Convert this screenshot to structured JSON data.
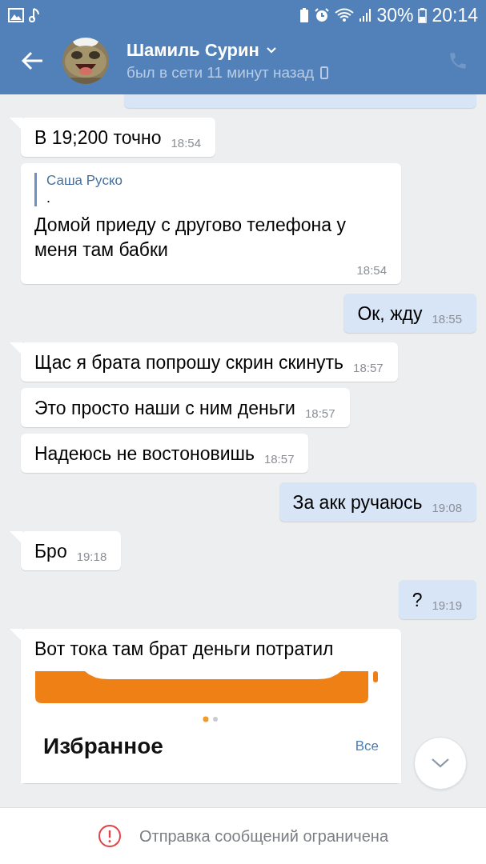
{
  "status_bar": {
    "battery": "30%",
    "time": "20:14"
  },
  "header": {
    "name": "Шамиль Сурин",
    "status": "был в сети 11 минут назад"
  },
  "messages": [
    {
      "kind": "stub",
      "outgoing": true
    },
    {
      "kind": "text",
      "outgoing": false,
      "tail": true,
      "text": "В 19;200 точно",
      "time": "18:54"
    },
    {
      "kind": "reply",
      "outgoing": false,
      "tail": false,
      "quote_author": "Саша Руско",
      "quote_text": ".",
      "text": "Домой приеду с другово телефона  у меня там бабки",
      "time": "18:54"
    },
    {
      "kind": "text",
      "outgoing": true,
      "tail": false,
      "text": "Ок, жду",
      "time": "18:55"
    },
    {
      "kind": "text",
      "outgoing": false,
      "tail": true,
      "text": "Щас я брата попрошу скрин скинуть",
      "time": "18:57"
    },
    {
      "kind": "text",
      "outgoing": false,
      "tail": false,
      "text": "Это просто наши с ним деньги",
      "time": "18:57"
    },
    {
      "kind": "text",
      "outgoing": false,
      "tail": false,
      "text": "Надеюсь не востоновишь",
      "time": "18:57"
    },
    {
      "kind": "text",
      "outgoing": true,
      "tail": false,
      "text": "За акк ручаюсь",
      "time": "19:08"
    },
    {
      "kind": "text",
      "outgoing": false,
      "tail": true,
      "text": "Бро",
      "time": "19:18"
    },
    {
      "kind": "text",
      "outgoing": true,
      "tail": false,
      "text": "?",
      "time": "19:19"
    },
    {
      "kind": "screenshot",
      "outgoing": false,
      "tail": true,
      "text": "Вот тока там брат деньги потратил",
      "shot_title": "Избранное",
      "shot_link": "Все"
    }
  ],
  "footer": {
    "notice": "Отправка сообщений ограничена"
  }
}
